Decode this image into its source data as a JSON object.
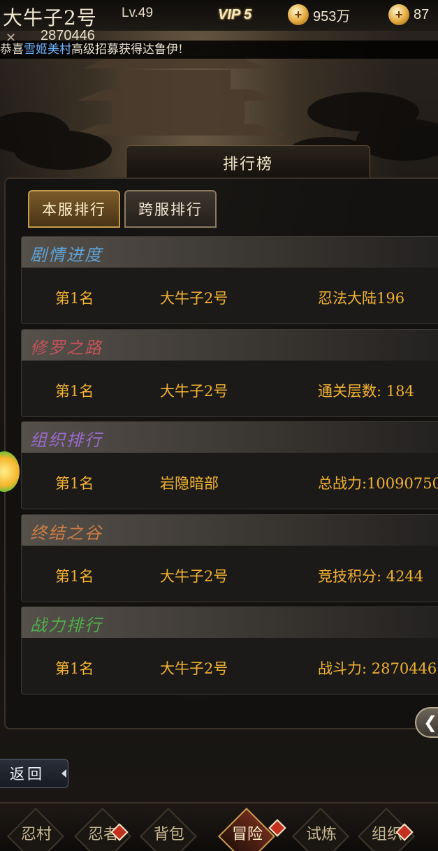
{
  "topbar": {
    "player_name": "大牛子2号",
    "level": "Lv.49",
    "vip": "VIP 5",
    "coins": "953万",
    "keys": "87",
    "combat_power": "2870446"
  },
  "ticker": {
    "prefix": "恭喜",
    "player": "雪姬美村",
    "suffix": "高级招募获得达鲁伊!"
  },
  "panel": {
    "title": "排行榜",
    "tabs": [
      {
        "label": "本服排行",
        "active": true
      },
      {
        "label": "跨服排行",
        "active": false
      }
    ]
  },
  "rankings": [
    {
      "title": "剧情进度",
      "title_color": "#5fa3d8",
      "rank": "第1名",
      "name": "大牛子2号",
      "value": "忍法大陆196"
    },
    {
      "title": "修罗之路",
      "title_color": "#c4535a",
      "rank": "第1名",
      "name": "大牛子2号",
      "value": "通关层数: 184"
    },
    {
      "title": "组织排行",
      "title_color": "#9b6ad0",
      "rank": "第1名",
      "name": "岩隐暗部",
      "value": "总战力:10090750"
    },
    {
      "title": "终结之谷",
      "title_color": "#cf7d45",
      "rank": "第1名",
      "name": "大牛子2号",
      "value": "竞技积分: 4244"
    },
    {
      "title": "战力排行",
      "title_color": "#4fae4c",
      "rank": "第1名",
      "name": "大牛子2号",
      "value": "战斗力: 2870446"
    }
  ],
  "controls": {
    "back_label": "返回",
    "collapse_icon": "chevron-left-icon"
  },
  "bottom_nav": [
    {
      "label": "忍村",
      "active": false,
      "badge": false
    },
    {
      "label": "忍者",
      "active": false,
      "badge": true
    },
    {
      "label": "背包",
      "active": false,
      "badge": false
    },
    {
      "label": "冒险",
      "active": true,
      "badge": true
    },
    {
      "label": "试炼",
      "active": false,
      "badge": false
    },
    {
      "label": "组织",
      "active": false,
      "badge": true
    }
  ]
}
